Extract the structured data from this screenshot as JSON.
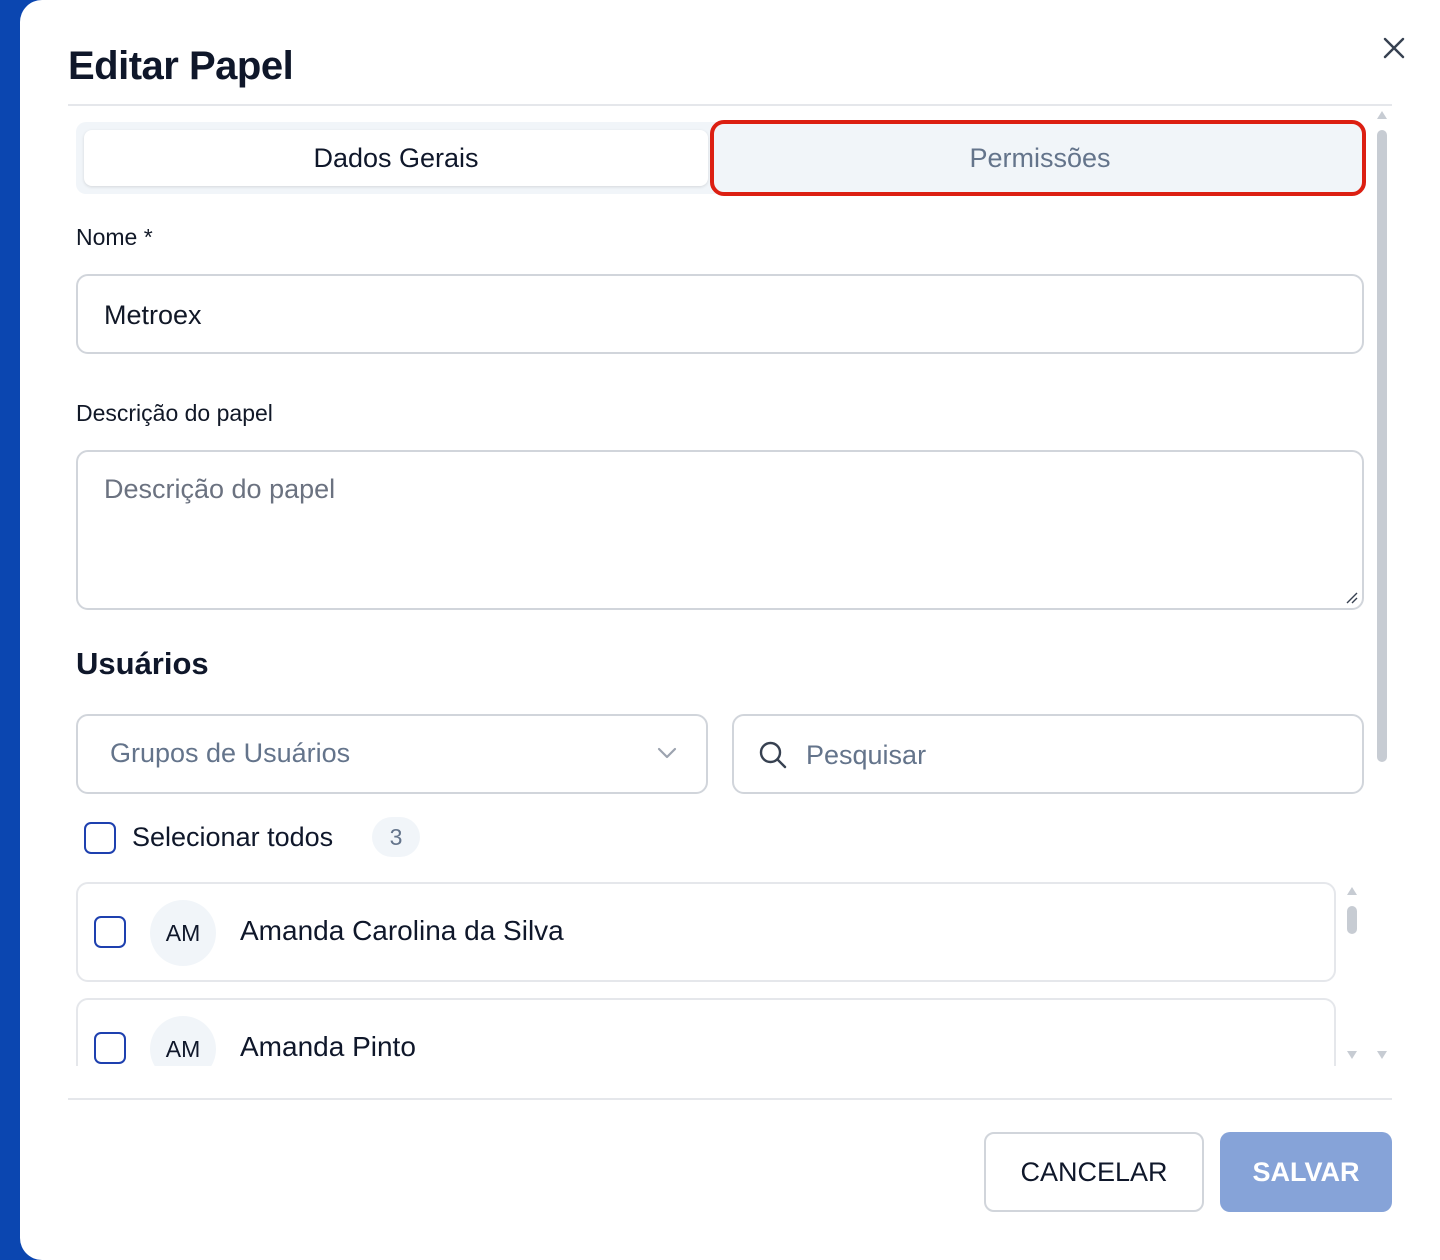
{
  "dialog": {
    "title": "Editar Papel",
    "close_icon": "close-icon"
  },
  "tabs": [
    {
      "label": "Dados Gerais",
      "active": true
    },
    {
      "label": "Permissões",
      "active": false
    }
  ],
  "form": {
    "name_label": "Nome *",
    "name_value": "Metroex",
    "description_label": "Descrição do papel",
    "description_placeholder": "Descrição do papel"
  },
  "users": {
    "section_title": "Usuários",
    "group_select_placeholder": "Grupos de Usuários",
    "search_placeholder": "Pesquisar",
    "select_all_label": "Selecionar todos",
    "count": "3",
    "list": [
      {
        "initials": "AM",
        "name": "Amanda Carolina da Silva"
      },
      {
        "initials": "AM",
        "name": "Amanda Pinto"
      }
    ]
  },
  "footer": {
    "cancel_label": "CANCELAR",
    "save_label": "SALVAR"
  },
  "colors": {
    "highlight": "#dc1f12",
    "accent": "#1e40af",
    "save_disabled": "#86a3d8"
  }
}
